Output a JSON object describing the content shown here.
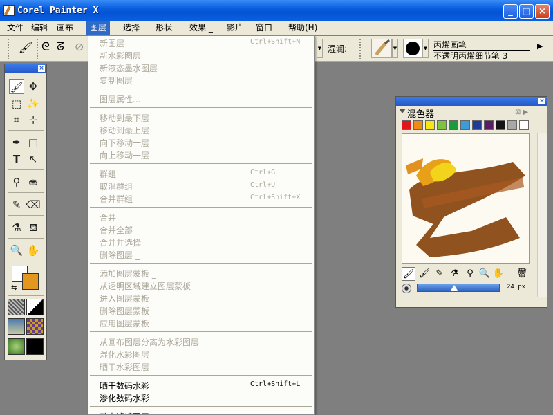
{
  "window": {
    "title": "Corel Painter X",
    "minimize_label": "_",
    "maximize_label": "□",
    "close_label": "×"
  },
  "menubar": {
    "items": [
      {
        "label": "文件"
      },
      {
        "label": "编辑"
      },
      {
        "label": "画布"
      },
      {
        "label": "图层"
      },
      {
        "label": "选择"
      },
      {
        "label": "形状"
      },
      {
        "label": "效果 _"
      },
      {
        "label": "影片"
      },
      {
        "label": "窗口"
      },
      {
        "label": "帮助(H)"
      }
    ],
    "active_index": 3
  },
  "toolbar": {
    "wet_label": "湿润:",
    "brush_category": "丙烯画笔",
    "brush_variant": "不透明丙烯细节笔 3"
  },
  "layer_menu": {
    "groups": [
      [
        {
          "label": "新图层",
          "shortcut": "Ctrl+Shift+N",
          "enabled": false
        },
        {
          "label": "新水彩图层",
          "shortcut": "",
          "enabled": false
        },
        {
          "label": "新液态墨水图层",
          "shortcut": "",
          "enabled": false
        },
        {
          "label": "复制图层",
          "shortcut": "",
          "enabled": false
        }
      ],
      [
        {
          "label": "图层属性...",
          "shortcut": "",
          "enabled": false
        }
      ],
      [
        {
          "label": "移动到最下层",
          "shortcut": "",
          "enabled": false
        },
        {
          "label": "移动到最上层",
          "shortcut": "",
          "enabled": false
        },
        {
          "label": "向下移动一层",
          "shortcut": "",
          "enabled": false
        },
        {
          "label": "向上移动一层",
          "shortcut": "",
          "enabled": false
        }
      ],
      [
        {
          "label": "群组",
          "shortcut": "Ctrl+G",
          "enabled": false
        },
        {
          "label": "取消群组",
          "shortcut": "Ctrl+U",
          "enabled": false
        },
        {
          "label": "合并群组",
          "shortcut": "Ctrl+Shift+X",
          "enabled": false
        }
      ],
      [
        {
          "label": "合并",
          "shortcut": "",
          "enabled": false
        },
        {
          "label": "合并全部",
          "shortcut": "",
          "enabled": false
        },
        {
          "label": "合并并选择",
          "shortcut": "",
          "enabled": false
        },
        {
          "label": "删除图层 _",
          "shortcut": "",
          "enabled": false
        }
      ],
      [
        {
          "label": "添加图层蒙板 _",
          "shortcut": "",
          "enabled": false
        },
        {
          "label": "从透明区域建立图层蒙板",
          "shortcut": "",
          "enabled": false
        },
        {
          "label": "进入图层蒙板",
          "shortcut": "",
          "enabled": false
        },
        {
          "label": "删除图层蒙板",
          "shortcut": "",
          "enabled": false
        },
        {
          "label": "应用图层蒙板",
          "shortcut": "",
          "enabled": false
        }
      ],
      [
        {
          "label": "从画布图层分离为水彩图层",
          "shortcut": "",
          "enabled": false
        },
        {
          "label": "湿化水彩图层",
          "shortcut": "",
          "enabled": false
        },
        {
          "label": "晒干水彩图层",
          "shortcut": "",
          "enabled": false
        }
      ],
      [
        {
          "label": "晒干数码水彩",
          "shortcut": "Ctrl+Shift+L",
          "enabled": true
        },
        {
          "label": "渗化数码水彩",
          "shortcut": "",
          "enabled": true
        }
      ],
      [
        {
          "label": "动态滤镜图层",
          "shortcut": "",
          "enabled": true
        }
      ]
    ]
  },
  "mixer": {
    "title": "混色器",
    "colors": [
      "#e0161c",
      "#f08c14",
      "#f5e614",
      "#7cc43c",
      "#1a9c3c",
      "#3c9cd8",
      "#1e3c98",
      "#5a1e64",
      "#141414",
      "#a8a8a8",
      "#ffffff"
    ],
    "size_readout": "24 px"
  },
  "toolbox": {
    "primary_color": "#ffffff",
    "secondary_color": "#e4971e"
  }
}
